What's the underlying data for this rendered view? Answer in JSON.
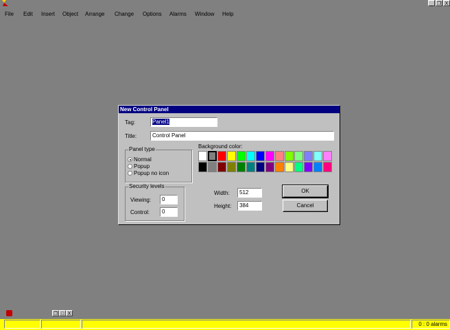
{
  "menu": {
    "items": [
      "File",
      "Edit",
      "Insert",
      "Object",
      "Arrange",
      "Change",
      "Options",
      "Alarms",
      "Window",
      "Help"
    ]
  },
  "window_controls": {
    "minimize": "_",
    "restore": "❐",
    "close": "X"
  },
  "dialog": {
    "title": "New Control Panel",
    "tag_label": "Tag:",
    "tag_value": "Panel1",
    "title_label": "Title:",
    "title_value": "Control Panel",
    "panel_type": {
      "legend": "Panel type",
      "options": [
        "Normal",
        "Popup",
        "Popup no icon"
      ],
      "selected": "Normal"
    },
    "security": {
      "legend": "Security levels",
      "viewing_label": "Viewing:",
      "viewing_value": "0",
      "control_label": "Control:",
      "control_value": "0"
    },
    "background_color_label": "Background color:",
    "colors": [
      "#ffffff",
      "#808080",
      "#ff0000",
      "#ffff00",
      "#00ff00",
      "#00ffff",
      "#0000ff",
      "#ff00ff",
      "#ff8080",
      "#80ff00",
      "#80ff80",
      "#8080ff",
      "#80ffff",
      "#ff80ff",
      "#000000",
      "#808080",
      "#800000",
      "#808000",
      "#008000",
      "#008080",
      "#000080",
      "#800080",
      "#ff8000",
      "#ffff80",
      "#00ff80",
      "#8000ff",
      "#0080ff",
      "#ff0080"
    ],
    "selected_color_index": 1,
    "width_label": "Width:",
    "width_value": "512",
    "height_label": "Height:",
    "height_value": "384",
    "ok_label": "OK",
    "cancel_label": "Cancel"
  },
  "minimized": {
    "restore": "❐",
    "maximize": "□",
    "close": "X"
  },
  "status": {
    "alarms_text": "0 : 0 alarms",
    "bar_color": "#ffff00"
  }
}
